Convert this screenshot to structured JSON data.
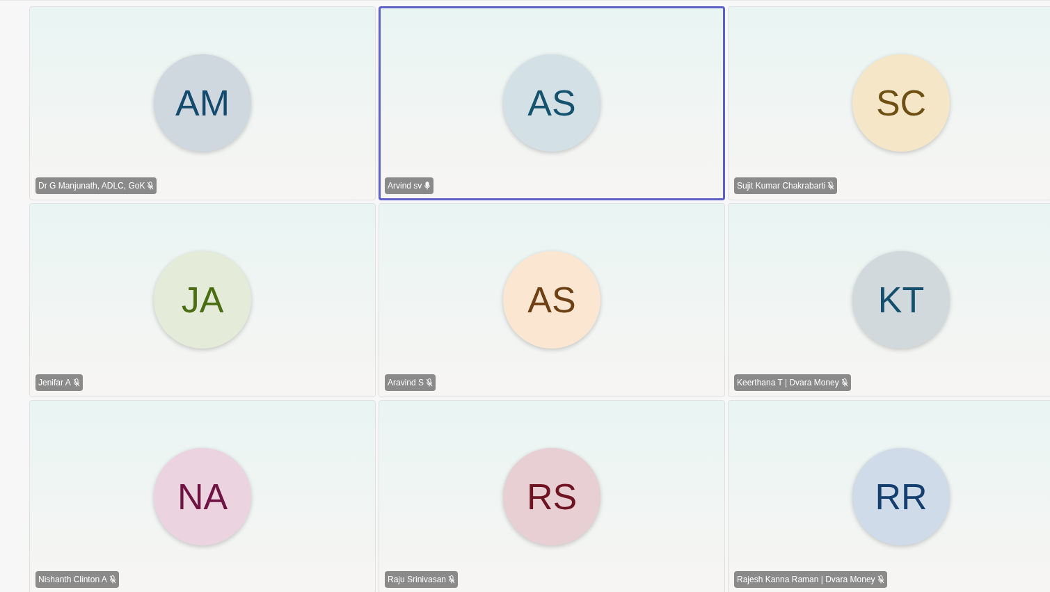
{
  "participants": [
    {
      "initials": "AM",
      "name": "Dr G Manjunath, ADLC, GoK",
      "muted": true,
      "selected": false,
      "color": "#cfd8de"
    },
    {
      "initials": "AS",
      "name": "Arvind sv",
      "muted": false,
      "selected": true,
      "color": "#d3e0e6"
    },
    {
      "initials": "SC",
      "name": "Sujit Kumar Chakrabarti",
      "muted": true,
      "selected": false,
      "color": "#f5e6c8"
    },
    {
      "initials": "JA",
      "name": "Jenifar A",
      "muted": true,
      "selected": false,
      "color": "#e4ebd9"
    },
    {
      "initials": "AS",
      "name": "Aravind S",
      "muted": true,
      "selected": false,
      "color": "#fbe6d2"
    },
    {
      "initials": "KT",
      "name": "Keerthana T | Dvara Money",
      "muted": true,
      "selected": false,
      "color": "#d1d9dd"
    },
    {
      "initials": "NA",
      "name": "Nishanth Clinton A",
      "muted": true,
      "selected": false,
      "color": "#ecd3e0"
    },
    {
      "initials": "RS",
      "name": "Raju Srinivasan",
      "muted": true,
      "selected": false,
      "color": "#e8cfd3"
    },
    {
      "initials": "RR",
      "name": "Rajesh Kanna Raman | Dvara Money",
      "muted": true,
      "selected": false,
      "color": "#cfdbe8"
    }
  ]
}
